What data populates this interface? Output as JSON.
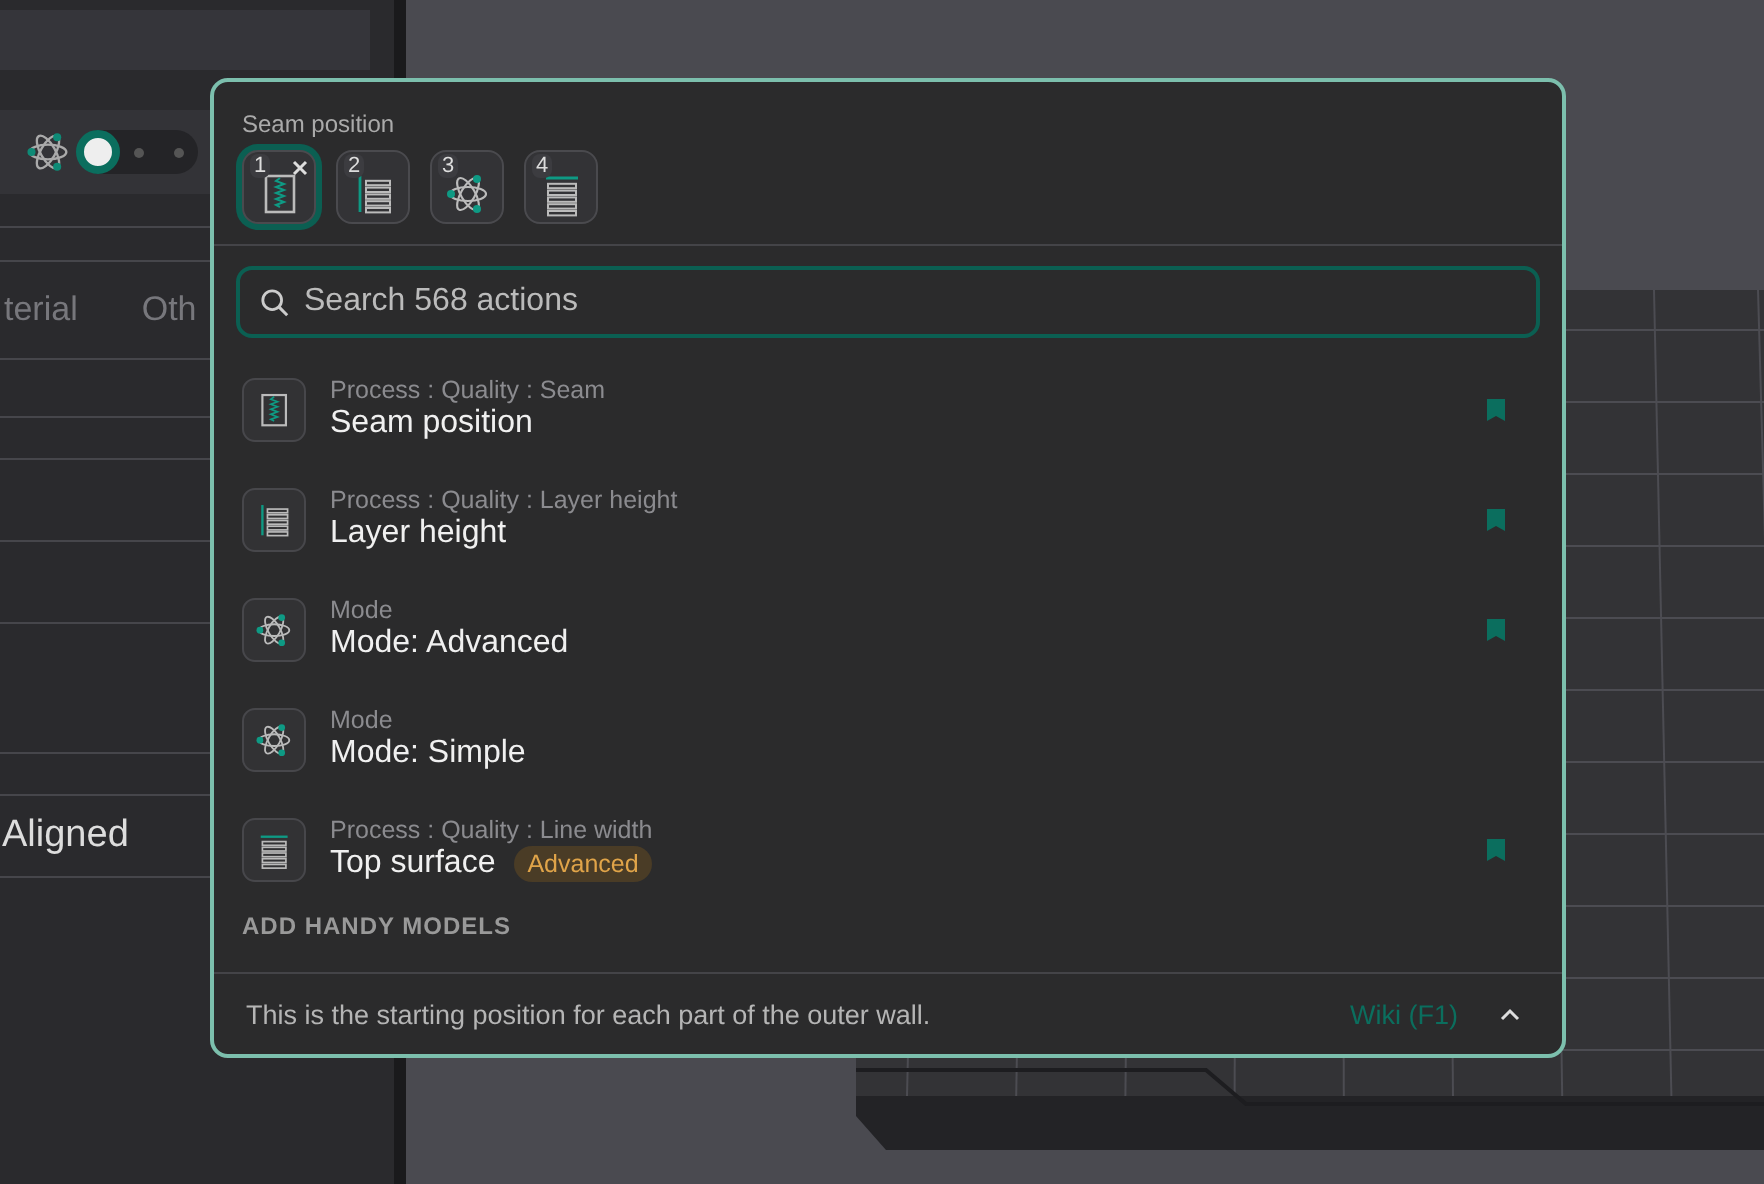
{
  "sidebar": {
    "tabs": [
      {
        "label": "terial",
        "selected": false
      },
      {
        "label": "Oth",
        "selected": false
      }
    ],
    "mode_switch": [
      {
        "selected": true
      },
      {
        "selected": false
      },
      {
        "selected": false
      }
    ],
    "rows": [
      {
        "value": "Aligned"
      }
    ]
  },
  "palette": {
    "title": "Seam position",
    "recent": [
      {
        "number": "1",
        "kind": "seam",
        "selected": true,
        "closable": true
      },
      {
        "number": "2",
        "kind": "layers",
        "selected": false,
        "closable": false
      },
      {
        "number": "3",
        "kind": "atom",
        "selected": false,
        "closable": false
      },
      {
        "number": "4",
        "kind": "top",
        "selected": false,
        "closable": false
      }
    ],
    "search": {
      "placeholder": "Search 568 actions"
    },
    "results": [
      {
        "kind": "seam",
        "path": "Process : Quality : Seam",
        "title": "Seam position",
        "bookmarked": true
      },
      {
        "kind": "layers",
        "path": "Process : Quality : Layer height",
        "title": "Layer height",
        "bookmarked": true
      },
      {
        "kind": "atom",
        "path": "Mode",
        "title": "Mode: Advanced",
        "bookmarked": true
      },
      {
        "kind": "atom",
        "path": "Mode",
        "title": "Mode: Simple",
        "bookmarked": false
      },
      {
        "kind": "top",
        "path": "Process : Quality : Line width",
        "title": "Top surface",
        "badge": "Advanced",
        "bookmarked": true
      }
    ],
    "section_heading": "ADD HANDY MODELS",
    "footer": {
      "description": "This is the starting position for each part of the outer wall.",
      "link": "Wiki (F1)"
    }
  }
}
